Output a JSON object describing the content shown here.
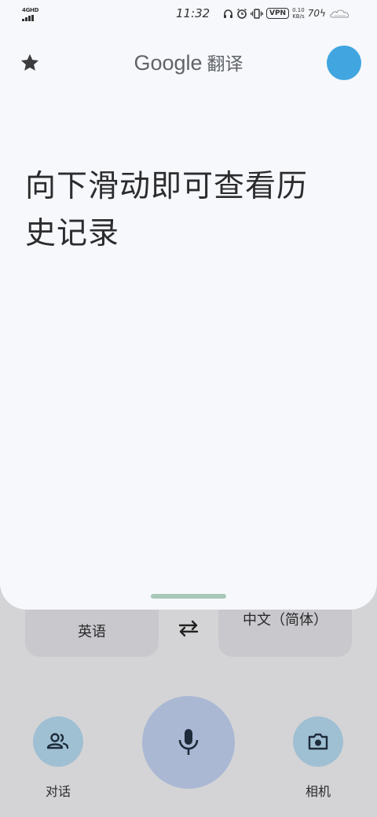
{
  "status_bar": {
    "network": "4GHD",
    "time": "11:32",
    "vpn": "VPN",
    "speed_value": "0.10",
    "speed_unit": "KB/s",
    "battery": "70"
  },
  "header": {
    "brand_google": "Google",
    "brand_product": "翻译",
    "favorites_icon": "star-icon",
    "avatar_color": "#41a6e0"
  },
  "main": {
    "hint": "向下滑动即可查看历史记录"
  },
  "languages": {
    "source": "英语",
    "target": "中文（简体）",
    "swap_icon": "swap-arrows-icon"
  },
  "actions": {
    "conversation_label": "对话",
    "conversation_icon": "people-icon",
    "mic_icon": "microphone-icon",
    "camera_label": "相机",
    "camera_icon": "camera-icon"
  },
  "colors": {
    "accent": "#41a6e0",
    "mic_button": "#aab8d4",
    "side_buttons": "#9fbfd3"
  }
}
